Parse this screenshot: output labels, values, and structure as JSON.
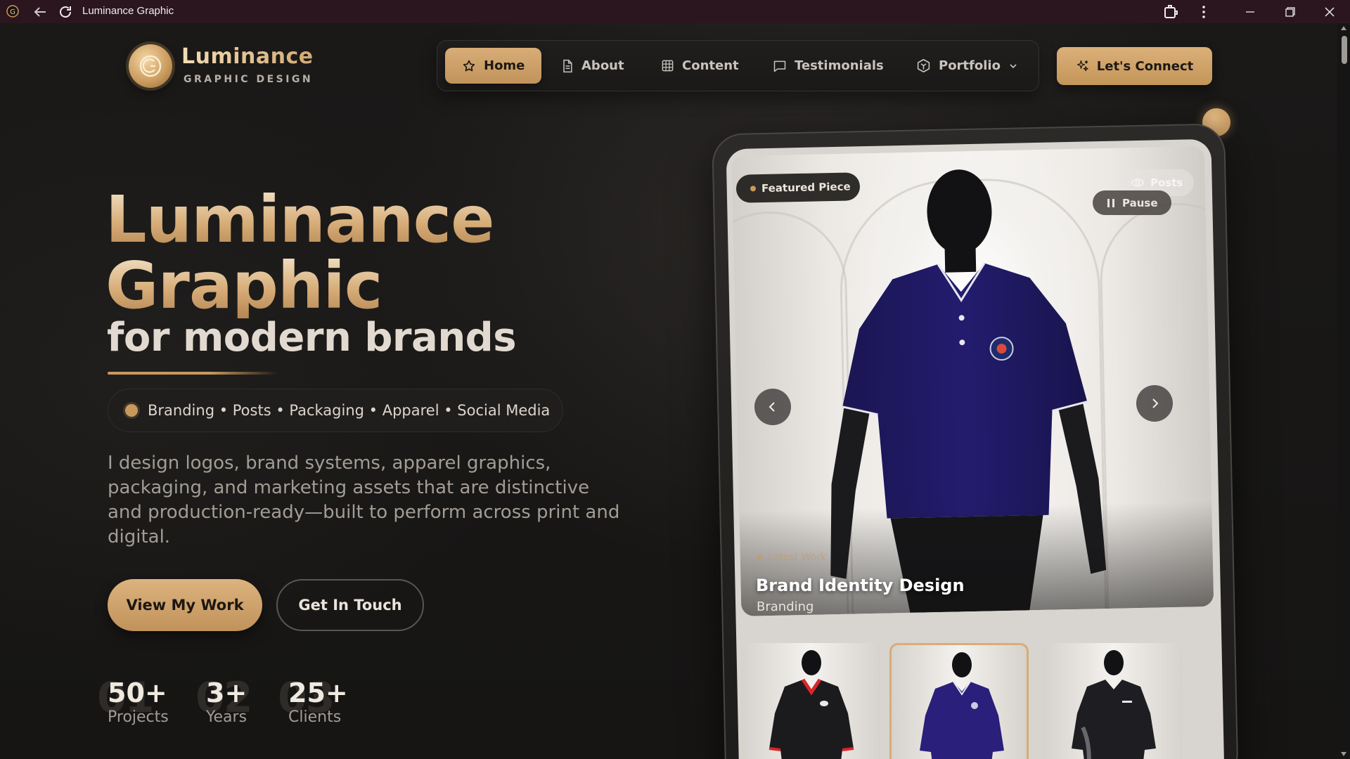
{
  "window": {
    "title": "Luminance Graphic",
    "icons": [
      "app-logo-icon",
      "back-arrow-icon",
      "reload-icon",
      "extensions-icon",
      "more-vertical-icon",
      "minimize-icon",
      "maximize-icon",
      "close-icon"
    ]
  },
  "brand": {
    "name": "Luminance",
    "tagline": "GRAPHIC DESIGN",
    "accent": "#c9995c"
  },
  "nav": {
    "items": [
      {
        "label": "Home",
        "icon": "star-icon",
        "active": true
      },
      {
        "label": "About",
        "icon": "document-icon",
        "active": false
      },
      {
        "label": "Content",
        "icon": "grid-icon",
        "active": false
      },
      {
        "label": "Testimonials",
        "icon": "chat-bubble-icon",
        "active": false
      },
      {
        "label": "Portfolio",
        "icon": "hexagon-icon",
        "active": false,
        "dropdown": true
      }
    ],
    "cta": "Let's Connect"
  },
  "hero": {
    "line1": "Luminance",
    "line2": "Graphic",
    "line3": "for modern brands",
    "services": "Branding • Posts • Packaging • Apparel • Social Media",
    "description": "I design logos, brand systems, apparel graphics, packaging, and marketing assets that are distinctive and production-ready—built to perform across print and digital.",
    "primary_button": "View My Work",
    "secondary_button": "Get In Touch"
  },
  "stats": [
    {
      "ghost": "01",
      "value": "50+",
      "label": "Projects"
    },
    {
      "ghost": "02",
      "value": "3+",
      "label": "Years"
    },
    {
      "ghost": "03",
      "value": "25+",
      "label": "Clients"
    }
  ],
  "showcase": {
    "badge": "Featured Piece",
    "posts_label": "Posts",
    "pause_label": "Pause",
    "latest_label": "Latest Work",
    "title": "Brand Identity Design",
    "category": "Branding",
    "thumbnails": [
      {
        "shirt_color": "#1b1b1e",
        "collar_color": "#d9262a",
        "active": false
      },
      {
        "shirt_color": "#2a1f7a",
        "collar_color": "#2a1f7a",
        "active": true
      },
      {
        "shirt_color": "#1e1e22",
        "collar_color": "#1e1e22",
        "active": false
      }
    ]
  }
}
